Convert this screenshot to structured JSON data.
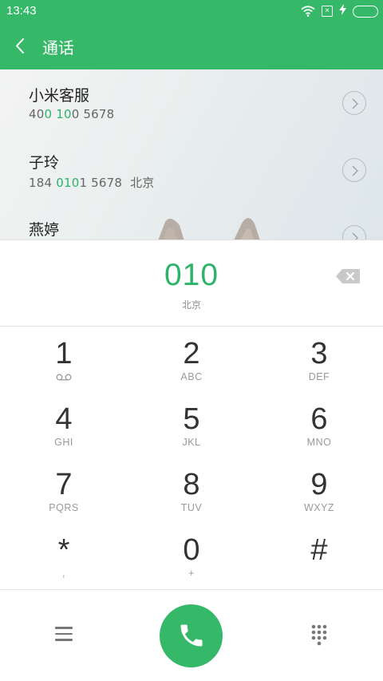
{
  "status_bar": {
    "time": "13:43",
    "sim_icon_text": "×"
  },
  "app_bar": {
    "title": "通话"
  },
  "results": [
    {
      "name": "小米客服",
      "number_prefix": "40",
      "number_match": "0 10",
      "number_suffix": "0 5678",
      "location": ""
    },
    {
      "name": "子玲",
      "number_prefix": "184 ",
      "number_match": "010",
      "number_suffix": "1 5678",
      "location": "北京"
    },
    {
      "name": "燕婷",
      "number_prefix": "",
      "number_match": "",
      "number_suffix": "",
      "location": ""
    }
  ],
  "display": {
    "dialed": "010",
    "location": "北京"
  },
  "keys": [
    {
      "digit": "1",
      "letters": ""
    },
    {
      "digit": "2",
      "letters": "ABC"
    },
    {
      "digit": "3",
      "letters": "DEF"
    },
    {
      "digit": "4",
      "letters": "GHI"
    },
    {
      "digit": "5",
      "letters": "JKL"
    },
    {
      "digit": "6",
      "letters": "MNO"
    },
    {
      "digit": "7",
      "letters": "PQRS"
    },
    {
      "digit": "8",
      "letters": "TUV"
    },
    {
      "digit": "9",
      "letters": "WXYZ"
    },
    {
      "digit": "*",
      "letters": ","
    },
    {
      "digit": "0",
      "letters": "+"
    },
    {
      "digit": "#",
      "letters": ""
    }
  ],
  "icons": {
    "status": [
      "wifi-icon",
      "sim-icon",
      "charging-icon",
      "battery-icon"
    ],
    "app_bar": [
      "back-arrow-icon"
    ],
    "display": [
      "backspace-icon"
    ],
    "keypad": [
      "voicemail-icon"
    ],
    "bottom": [
      "menu-icon",
      "phone-icon",
      "dialpad-icon"
    ]
  },
  "colors": {
    "accent": "#36b869",
    "highlight": "#2db36a",
    "text": "#333333",
    "muted": "#9a9a9a"
  }
}
